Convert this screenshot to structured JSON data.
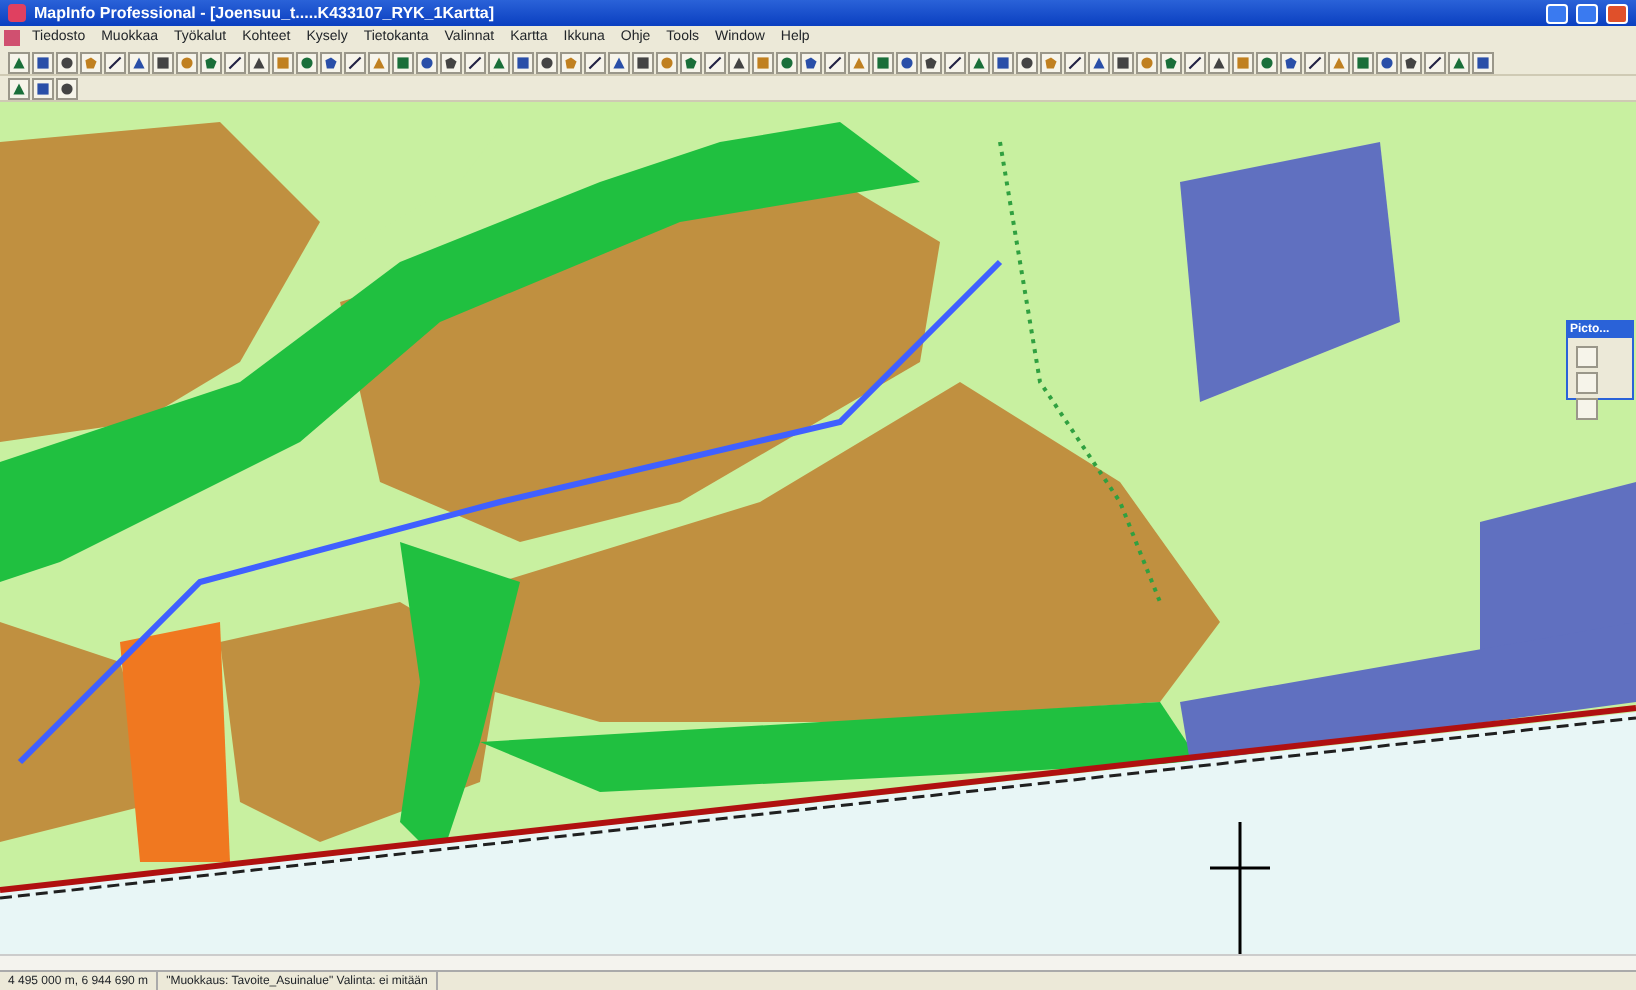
{
  "window": {
    "title": "MapInfo Professional - [Joensuu_t.....K433107_RYK_1Kartta]"
  },
  "menu": [
    "Tiedosto",
    "Muokkaa",
    "Työkalut",
    "Kohteet",
    "Kysely",
    "Tietokanta",
    "Valinnat",
    "Kartta",
    "Ikkuna",
    "Ohje",
    "Tools",
    "Window",
    "Help"
  ],
  "palette": {
    "title": "Picto..."
  },
  "status_bar": [
    "4 495 000 m, 6 944 690 m",
    "\"Muokkaus: Tavoite_Asuinalue\" Valinta: ei mitään"
  ]
}
